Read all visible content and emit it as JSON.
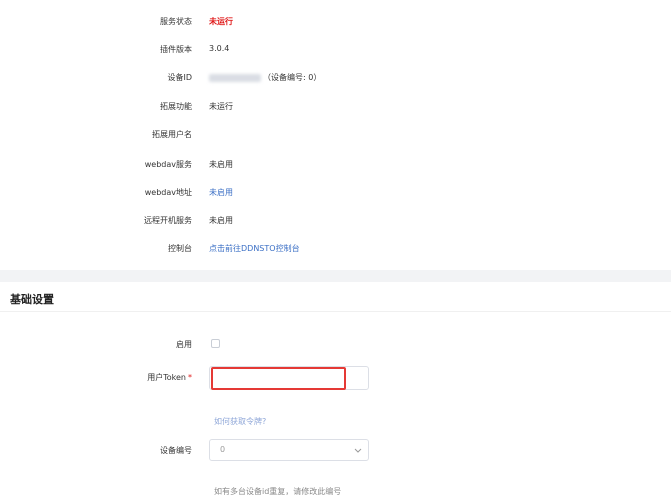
{
  "status": {
    "rows": [
      {
        "label": "服务状态",
        "value": "未运行"
      },
      {
        "label": "插件版本",
        "value": "3.0.4"
      },
      {
        "label": "设备ID",
        "value": "（设备编号: 0）"
      },
      {
        "label": "拓展功能",
        "value": "未运行"
      },
      {
        "label": "拓展用户名",
        "value": ""
      },
      {
        "label": "webdav服务",
        "value": "未启用"
      },
      {
        "label": "webdav地址",
        "value": "未启用"
      },
      {
        "label": "远程开机服务",
        "value": "未启用"
      },
      {
        "label": "控制台",
        "value": "点击前往DDNSTO控制台"
      }
    ]
  },
  "basic": {
    "title": "基础设置",
    "enable_label": "启用",
    "token_label": "用户Token",
    "token_required_mark": "*",
    "token_value": "",
    "token_help": "如何获取令牌?",
    "device_label": "设备编号",
    "device_value": "0",
    "device_help": "如有多台设备id重复，请修改此编号"
  },
  "colors": {
    "accent_link": "#3b6fc5",
    "error": "#e01919",
    "highlight_border": "#e53935"
  }
}
